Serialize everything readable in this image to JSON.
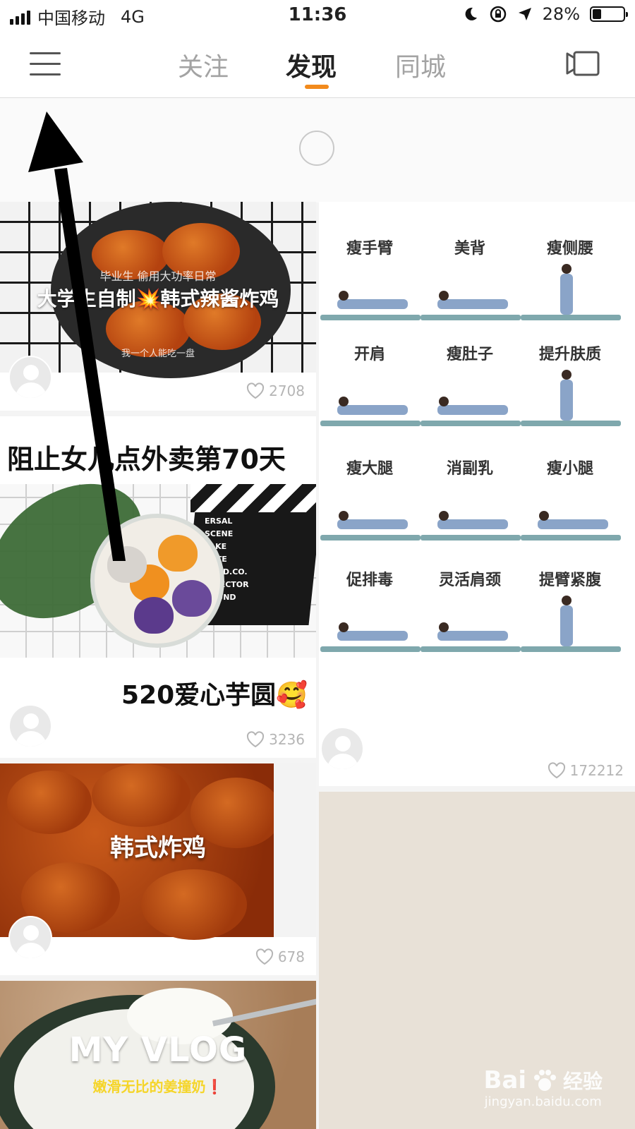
{
  "status_bar": {
    "carrier": "中国移动",
    "network": "4G",
    "time": "11:36",
    "battery_percent": "28%",
    "battery_level": 0.28,
    "icons": [
      "signal-icon",
      "moon-icon",
      "rotation-lock-icon",
      "location-arrow-icon",
      "battery-icon"
    ]
  },
  "nav": {
    "tabs": [
      {
        "label": "关注",
        "active": false
      },
      {
        "label": "发现",
        "active": true
      },
      {
        "label": "同城",
        "active": false
      }
    ],
    "accent_color": "#f28a1c",
    "icons": [
      "menu-icon",
      "camera-icon"
    ]
  },
  "feed": {
    "left": [
      {
        "overlay_top": "毕业生 偷用大功率日常",
        "overlay_title": "大学生自制💥韩式辣酱炸鸡",
        "overlay_bottom": "我一个人能吃一盘",
        "likes": "2708"
      },
      {
        "title": "阻止女儿点外卖第70天",
        "clapper_text": [
          "ERSAL",
          "SCENE",
          "TAKE",
          "DATE",
          "PROD.CO.",
          "DIRECTOR",
          "SOUND"
        ],
        "caption": "520爱心芋圆🥰",
        "likes": "3236"
      },
      {
        "overlay_title": "韩式炸鸡",
        "likes": "678"
      },
      {
        "overlay_title": "MY VLOG",
        "overlay_subtitle": "嫩滑无比的姜撞奶❗"
      }
    ],
    "right": [
      {
        "yoga_labels": [
          [
            "瘦手臂",
            "美背",
            "瘦侧腰"
          ],
          [
            "开肩",
            "瘦肚子",
            "提升肤质"
          ],
          [
            "瘦大腿",
            "消副乳",
            "瘦小腿"
          ],
          [
            "促排毒",
            "灵活肩颈",
            "提臂紧腹"
          ]
        ],
        "likes": "172212"
      }
    ]
  },
  "watermark": {
    "brand": "Bai",
    "brand_cn": "经验",
    "url": "jingyan.baidu.com"
  }
}
